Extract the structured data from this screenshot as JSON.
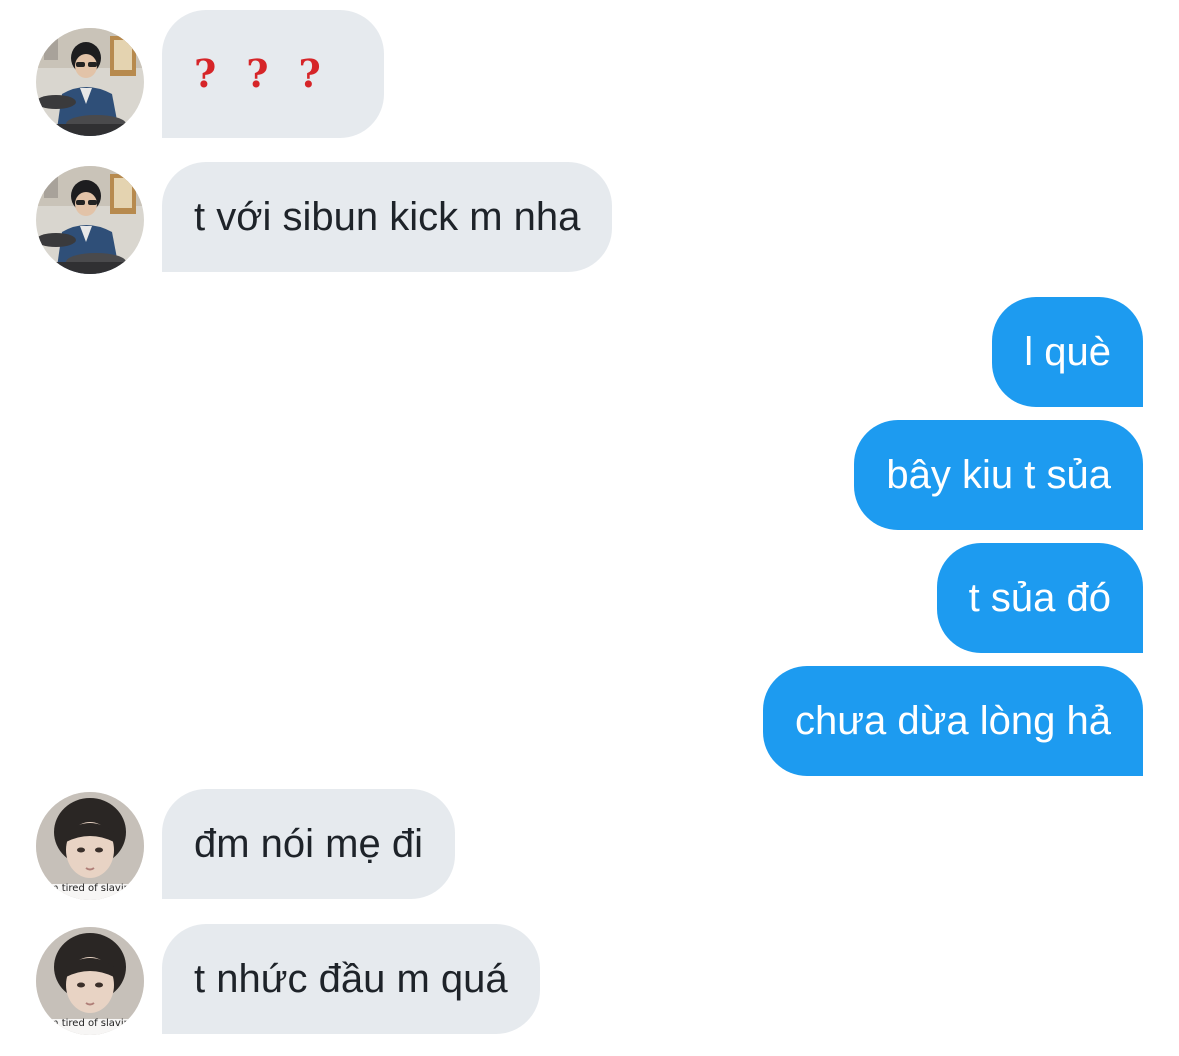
{
  "conversation": {
    "messages": [
      {
        "id": "m1",
        "direction": "incoming",
        "sender_avatar": "avatar-drummer",
        "text": "? ? ?",
        "style": "red-question-marks"
      },
      {
        "id": "m2",
        "direction": "incoming",
        "sender_avatar": "avatar-drummer",
        "text": "t với sibun kick m nha"
      },
      {
        "id": "m3",
        "direction": "outgoing",
        "text": "l què"
      },
      {
        "id": "m4",
        "direction": "outgoing",
        "text": "bây kiu t sủa"
      },
      {
        "id": "m5",
        "direction": "outgoing",
        "text": "t sủa đó"
      },
      {
        "id": "m6",
        "direction": "outgoing",
        "text": "chưa dừa lòng hả"
      },
      {
        "id": "m7",
        "direction": "incoming",
        "sender_avatar": "avatar-portrait",
        "text": "đm nói mẹ đi"
      },
      {
        "id": "m8",
        "direction": "incoming",
        "sender_avatar": "avatar-portrait",
        "text": "t nhức đầu m quá"
      }
    ],
    "q1": "?",
    "q2": "?",
    "q3": "?",
    "avatar_caption": "im tired of slavin"
  },
  "colors": {
    "incoming_bubble": "#e6eaee",
    "outgoing_bubble": "#1d9bf0",
    "incoming_text": "#1e2329",
    "outgoing_text": "#ffffff",
    "question_mark": "#d62528"
  }
}
